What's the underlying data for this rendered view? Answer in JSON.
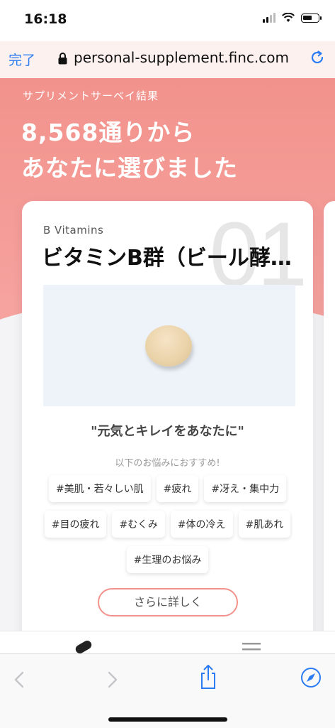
{
  "status_bar": {
    "time": "16:18"
  },
  "browser": {
    "done_label": "完了",
    "url": "personal-supplement.finc.com"
  },
  "hero": {
    "subtitle": "サプリメントサーベイ結果",
    "title_line1": "8,568通りから",
    "title_line2": "あなたに選びました"
  },
  "card": {
    "rank": "01",
    "category": "B Vitamins",
    "name": "ビタミンB群（ビール酵…",
    "catchphrase": "\"元気とキレイをあなたに\"",
    "recommend_label": "以下のお悩みにおすすめ!",
    "tags": [
      "#美肌・若々しい肌",
      "#疲れ",
      "#冴え・集中力",
      "#目の疲れ",
      "#むくみ",
      "#体の冷え",
      "#肌あれ",
      "#生理のお悩み"
    ],
    "more_button": "さらに詳しく"
  },
  "icons": {
    "lock": "lock-icon",
    "reload": "reload-icon",
    "back": "chevron-left-icon",
    "forward": "chevron-right-icon",
    "share": "share-icon",
    "compass": "compass-icon"
  },
  "colors": {
    "accent": "#f2928c",
    "link": "#2b7bf2"
  }
}
